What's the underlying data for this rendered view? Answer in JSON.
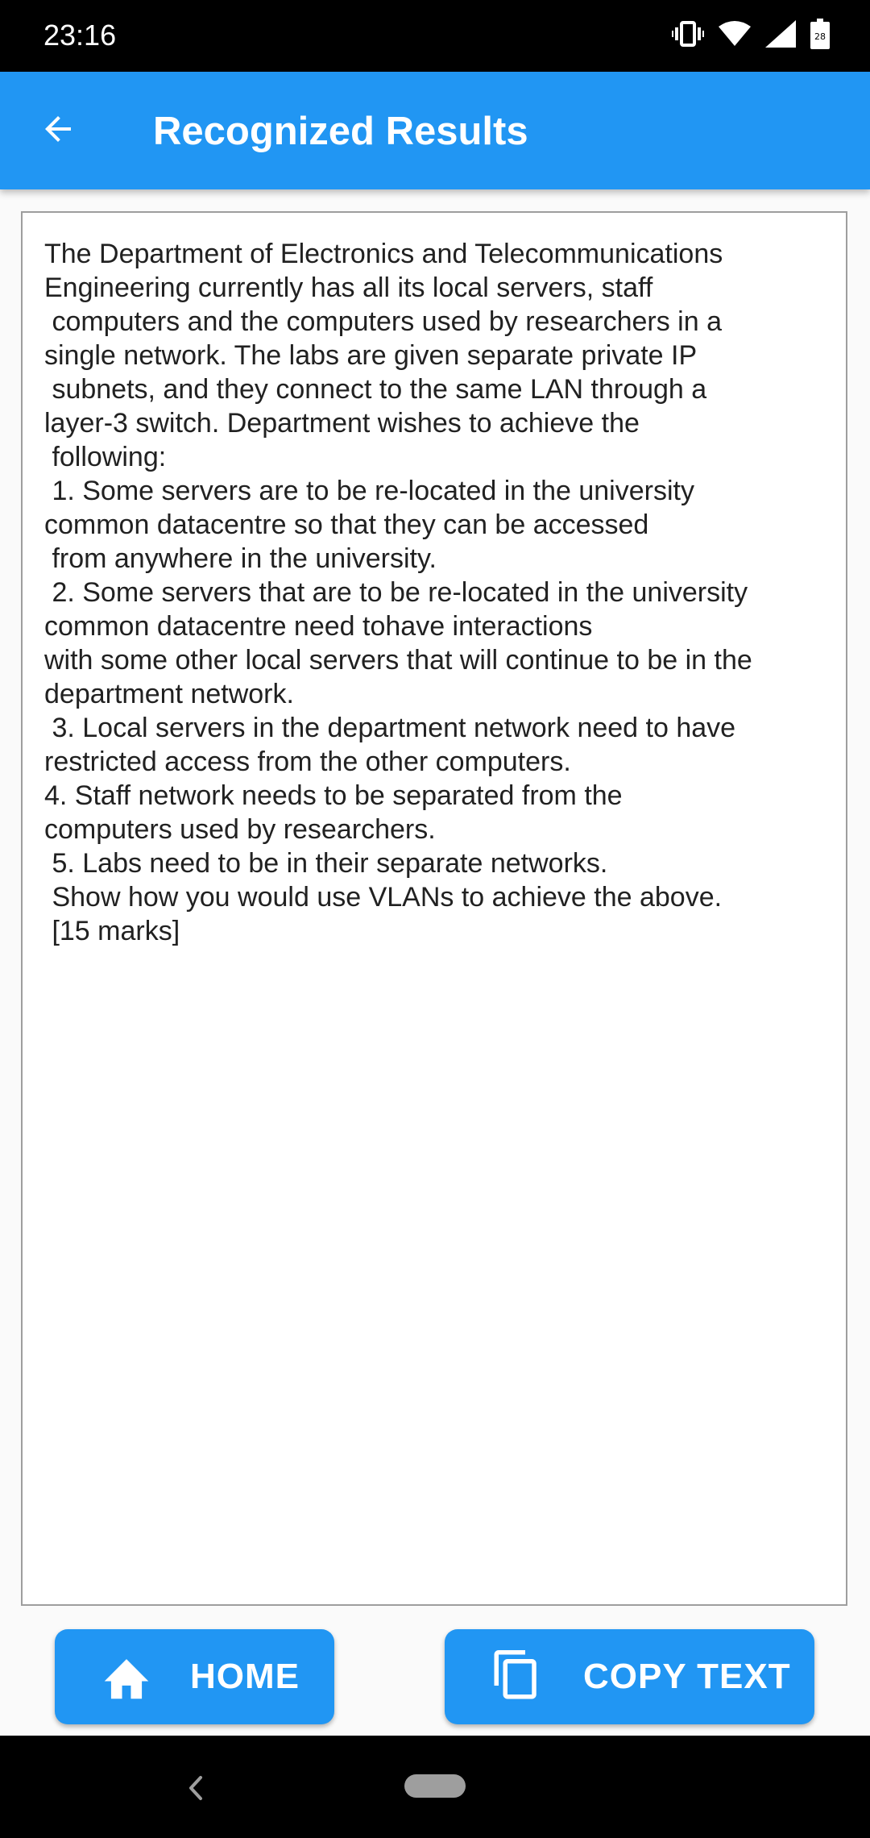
{
  "status_bar": {
    "time": "23:16",
    "icons": [
      "vibrate-icon",
      "wifi-icon",
      "signal-icon",
      "battery-icon"
    ],
    "battery_level": "28"
  },
  "app_bar": {
    "title": "Recognized Results",
    "back_icon": "arrow-back-icon",
    "color": "#2196f3"
  },
  "result": {
    "text": "The Department of Electronics and Telecommunications\nEngineering currently has all its local servers, staff\n computers and the computers used by researchers in a\nsingle network. The labs are given separate private IP\n subnets, and they connect to the same LAN through a\nlayer-3 switch. Department wishes to achieve the\n following:\n 1. Some servers are to be re-located in the university\ncommon datacentre so that they can be accessed\n from anywhere in the university.\n 2. Some servers that are to be re-located in the university\ncommon datacentre need tohave interactions\nwith some other local servers that will continue to be in the\ndepartment network.\n 3. Local servers in the department network need to have\nrestricted access from the other computers.\n4. Staff network needs to be separated from the\ncomputers used by researchers.\n 5. Labs need to be in their separate networks.\n Show how you would use VLANs to achieve the above.\n [15 marks]"
  },
  "buttons": {
    "home": {
      "label": "HOME",
      "icon": "home-icon"
    },
    "copy": {
      "label": "COPY TEXT",
      "icon": "copy-icon"
    }
  },
  "nav_bar": {
    "icons": [
      "nav-back-icon",
      "nav-home-pill"
    ]
  }
}
